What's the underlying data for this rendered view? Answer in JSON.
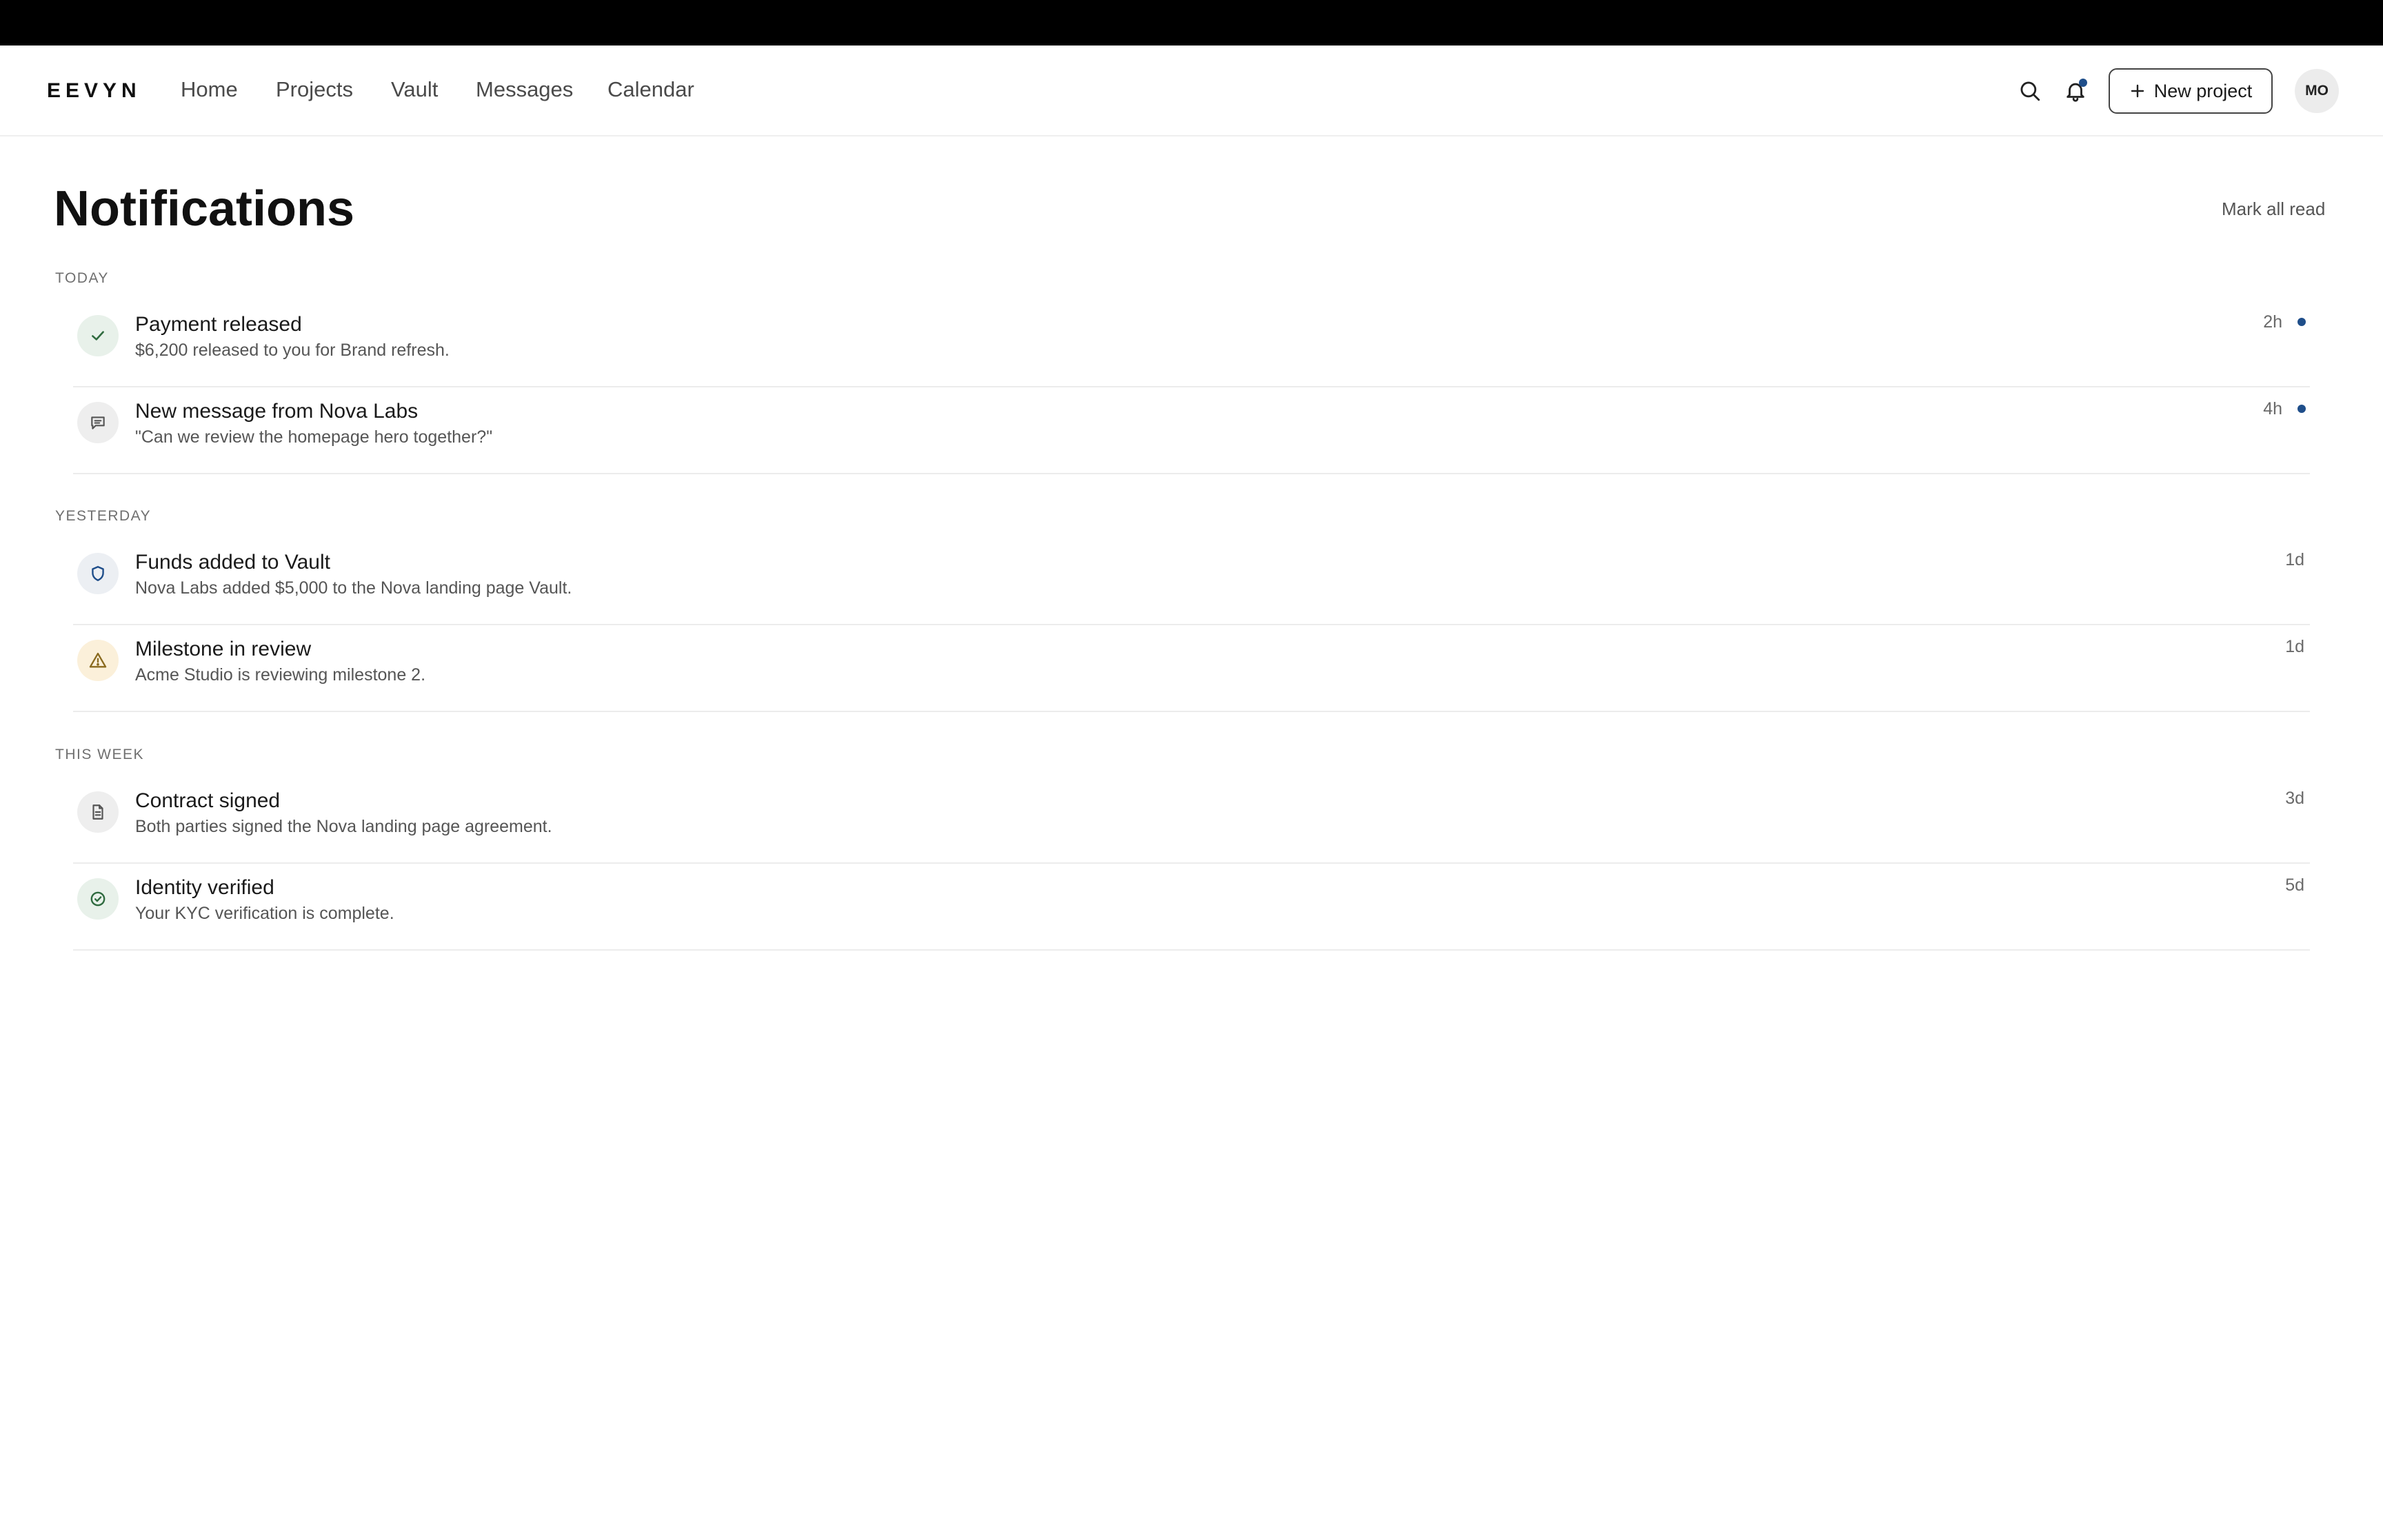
{
  "app": {
    "logo": "EEVYN"
  },
  "nav": {
    "links": [
      "Home",
      "Projects",
      "Vault",
      "Messages",
      "Calendar"
    ],
    "new_project_label": "New project",
    "avatar_initials": "MO",
    "icons": {
      "search": "search-icon",
      "bell": "bell-icon",
      "plus": "plus-icon"
    },
    "bell_has_unread": true
  },
  "page": {
    "title": "Notifications",
    "mark_all_read_label": "Mark all read"
  },
  "colors": {
    "accent": "#1f4e8a",
    "success_bg": "#e8f1ea",
    "success_fg": "#2f6b3f",
    "warning_bg": "#fbf0da",
    "warning_fg": "#8a6a1e",
    "neutral_bg": "#eeeeee",
    "neutral_fg": "#555555",
    "info_bg": "#eceff3",
    "info_fg": "#1f4e8a"
  },
  "sections": [
    {
      "label": "TODAY",
      "items": [
        {
          "icon": "check-icon",
          "tone": "success",
          "title": "Payment released",
          "body": "$6,200 released to you for Brand refresh.",
          "time": "2h",
          "unread": true
        },
        {
          "icon": "message-icon",
          "tone": "neutral",
          "title": "New message from Nova Labs",
          "body": "\"Can we review the homepage hero together?\"",
          "time": "4h",
          "unread": true
        }
      ]
    },
    {
      "label": "YESTERDAY",
      "items": [
        {
          "icon": "shield-icon",
          "tone": "info",
          "title": "Funds added to Vault",
          "body": "Nova Labs added $5,000 to the Nova landing page Vault.",
          "time": "1d",
          "unread": false
        },
        {
          "icon": "warning-icon",
          "tone": "warning",
          "title": "Milestone in review",
          "body": "Acme Studio is reviewing milestone 2.",
          "time": "1d",
          "unread": false
        }
      ]
    },
    {
      "label": "THIS WEEK",
      "items": [
        {
          "icon": "document-icon",
          "tone": "neutral",
          "title": "Contract signed",
          "body": "Both parties signed the Nova landing page agreement.",
          "time": "3d",
          "unread": false
        },
        {
          "icon": "check-circle-icon",
          "tone": "success",
          "title": "Identity verified",
          "body": "Your KYC verification is complete.",
          "time": "5d",
          "unread": false
        }
      ]
    }
  ]
}
